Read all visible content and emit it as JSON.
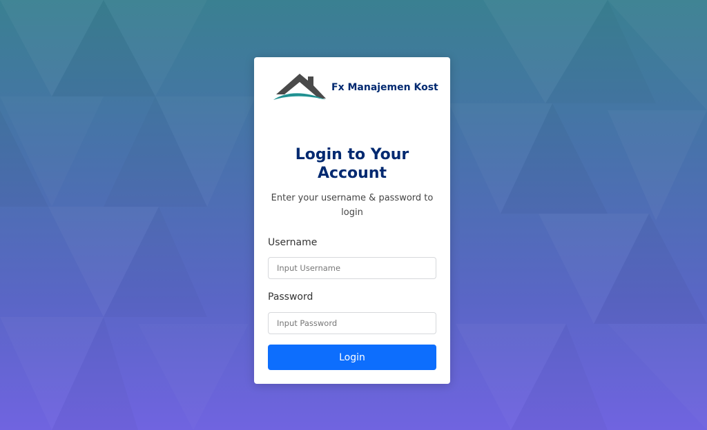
{
  "brand": {
    "name": "Fx Manajemen Kost",
    "logo_icon": "house-roof-icon"
  },
  "login": {
    "title": "Login to Your Account",
    "subtitle": "Enter your username & password to login",
    "username_label": "Username",
    "username_placeholder": "Input Username",
    "username_value": "",
    "password_label": "Password",
    "password_placeholder": "Input Password",
    "password_value": "",
    "submit_label": "Login"
  },
  "colors": {
    "brand_text": "#012970",
    "button": "#0d6efd",
    "background_top": "#3a8091",
    "background_bottom": "#7064e0"
  }
}
